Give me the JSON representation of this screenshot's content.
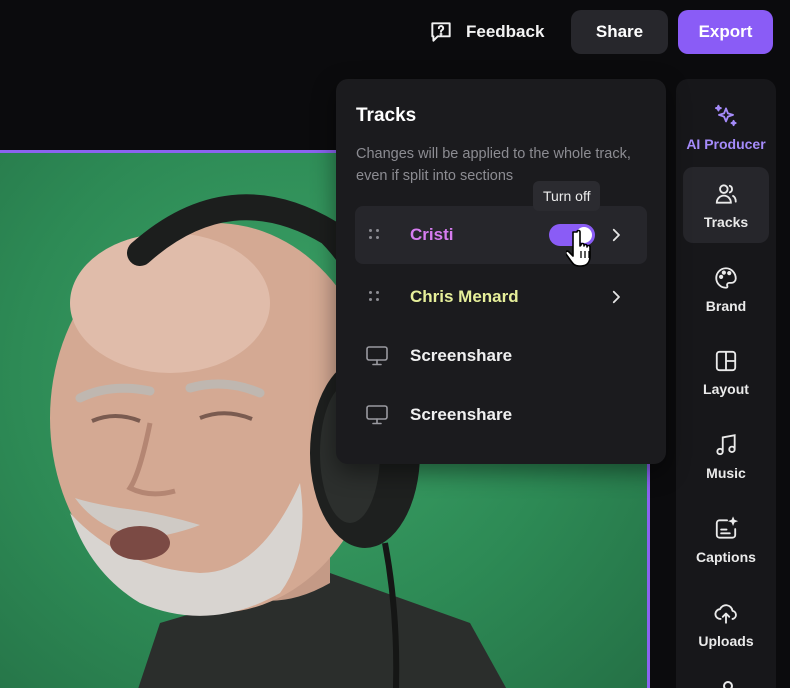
{
  "header": {
    "feedback_label": "Feedback",
    "share_label": "Share",
    "export_label": "Export"
  },
  "tracks_panel": {
    "title": "Tracks",
    "description": "Changes will be applied to the whole track, even if split into sections",
    "tooltip": "Turn off",
    "tracks": [
      {
        "name": "Cristi",
        "type": "camera",
        "color": "#d67cf0",
        "enabled": true
      },
      {
        "name": "Chris Menard",
        "type": "camera",
        "color": "#e6ef9a"
      },
      {
        "name": "Screenshare",
        "type": "screen",
        "color": "#f0f0f0",
        "icon": "monitor-icon"
      },
      {
        "name": "Screenshare",
        "type": "screen",
        "color": "#f0f0f0",
        "icon": "monitor-icon"
      }
    ]
  },
  "sidebar": {
    "items": [
      {
        "label": "AI Producer",
        "icon": "sparkles-icon"
      },
      {
        "label": "Tracks",
        "icon": "users-icon",
        "active": true
      },
      {
        "label": "Brand",
        "icon": "palette-icon"
      },
      {
        "label": "Layout",
        "icon": "layout-icon"
      },
      {
        "label": "Music",
        "icon": "music-note-icon"
      },
      {
        "label": "Captions",
        "icon": "captions-icon"
      },
      {
        "label": "Uploads",
        "icon": "upload-cloud-icon"
      }
    ]
  },
  "colors": {
    "accent": "#8a5cf6",
    "background": "#0b0b0d",
    "panel": "#1b1b1e",
    "green_screen": "#2f8f58"
  }
}
